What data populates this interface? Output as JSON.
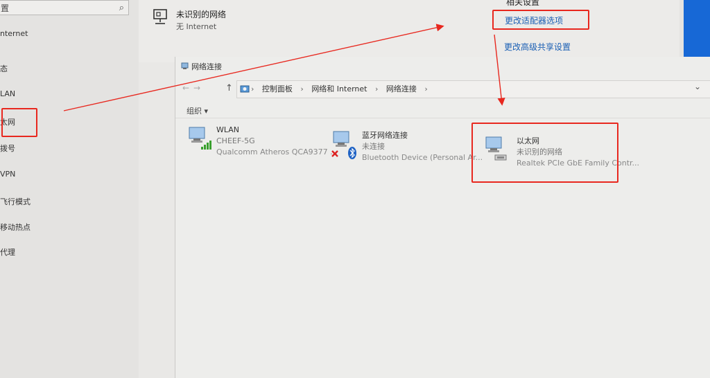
{
  "sidebar": {
    "search_text": "置",
    "items": [
      {
        "label": "nternet"
      },
      {
        "label": "态"
      },
      {
        "label": "LAN"
      },
      {
        "label": "太网"
      },
      {
        "label": "拨号"
      },
      {
        "label": "VPN"
      },
      {
        "label": "飞行模式"
      },
      {
        "label": "移动热点"
      },
      {
        "label": "代理"
      }
    ]
  },
  "settings": {
    "network_name": "未识别的网络",
    "network_status": "无 Internet",
    "related_title": "相关设置",
    "link_adapter": "更改适配器选项",
    "link_sharing": "更改高级共享设置"
  },
  "explorer": {
    "title": "网络连接",
    "breadcrumb": [
      "控制面板",
      "网络和 Internet",
      "网络连接"
    ],
    "organize_label": "组织 ▾",
    "connections": [
      {
        "name": "WLAN",
        "status": "CHEEF-5G",
        "device": "Qualcomm Atheros QCA9377 ..."
      },
      {
        "name": "蓝牙网络连接",
        "status": "未连接",
        "device": "Bluetooth Device (Personal Ar..."
      },
      {
        "name": "以太网",
        "status": "未识别的网络",
        "device": "Realtek PCIe GbE Family Contr..."
      }
    ]
  },
  "colors": {
    "highlight": "#e8271e",
    "link": "#1a5fb4",
    "accent": "#1768d6"
  }
}
